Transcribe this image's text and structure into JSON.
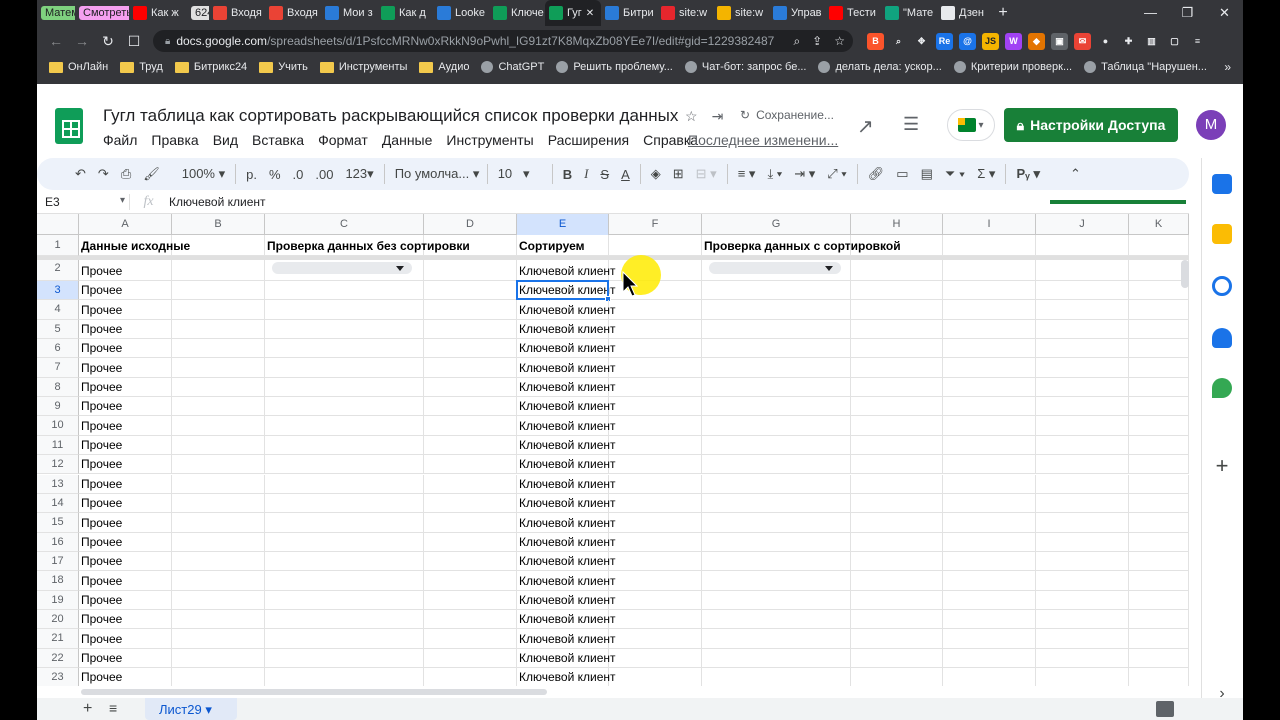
{
  "browser": {
    "tabs": [
      {
        "label": "Матем",
        "pill": true,
        "color": "#7fd17f"
      },
      {
        "label": "Смотреть",
        "pill": true,
        "color": "#f5a0f0"
      },
      {
        "label": "Как ж",
        "icon_color": "#ff0000",
        "icon": "youtube-icon"
      },
      {
        "label": "624",
        "pill": true,
        "color": "#e0e0e0"
      },
      {
        "label": "Входя",
        "icon_color": "#ea4335",
        "icon": "gmail-icon"
      },
      {
        "label": "Входя",
        "icon_color": "#ea4335",
        "icon": "gmail-icon"
      },
      {
        "label": "Мои з",
        "icon_color": "#2a7bd8",
        "icon": "bitrix-icon"
      },
      {
        "label": "Как д",
        "icon_color": "#0f9d58",
        "icon": "sheets-icon"
      },
      {
        "label": "Looke",
        "icon_color": "#2a7bd8",
        "icon": "bitrix-icon"
      },
      {
        "label": "Ключе",
        "icon_color": "#0f9d58",
        "icon": "sheets-icon"
      },
      {
        "label": "Гуг",
        "icon_color": "#0f9d58",
        "icon": "sheets-icon",
        "active": true
      },
      {
        "label": "Битри",
        "icon_color": "#2a7bd8",
        "icon": "bitrix-icon"
      },
      {
        "label": "site:w",
        "icon_color": "#e6262d",
        "icon": "yandex-icon"
      },
      {
        "label": "site:w",
        "icon_color": "#f4b400",
        "icon": "bookmark-icon"
      },
      {
        "label": "Управ",
        "icon_color": "#2a7bd8",
        "icon": "bitrix-icon"
      },
      {
        "label": "Тести",
        "icon_color": "#ff0000",
        "icon": "youtube-icon"
      },
      {
        "label": "\"Мате",
        "icon_color": "#10a37f",
        "icon": "chatgpt-icon"
      },
      {
        "label": "Дзен",
        "icon_color": "#e8eaed",
        "icon": "dzen-icon"
      }
    ],
    "url_host": "docs.google.com",
    "url_path": "/spreadsheets/d/1PsfccMRNw0xRkkN9oPwhl_IG91zt7K8MqxZb08YEe7I/edit#gid=1229382487",
    "bookmarks": [
      {
        "label": "ОнЛайн",
        "icon": "folder-icon"
      },
      {
        "label": "Труд",
        "icon": "folder-icon"
      },
      {
        "label": "Битрикс24",
        "icon": "folder-icon"
      },
      {
        "label": "Учить",
        "icon": "folder-icon"
      },
      {
        "label": "Инструменты",
        "icon": "folder-icon"
      },
      {
        "label": "Аудио",
        "icon": "folder-icon"
      },
      {
        "label": "ChatGPT",
        "icon": "chatgpt-icon"
      },
      {
        "label": "Решить проблему...",
        "icon": "page-icon"
      },
      {
        "label": "Чат-бот: запрос бе...",
        "icon": "bitrix-icon"
      },
      {
        "label": "делать дела: ускор...",
        "icon": "globe-icon"
      },
      {
        "label": "Критерии проверк...",
        "icon": "page-icon"
      },
      {
        "label": "Таблица \"Нарушен...",
        "icon": "page-icon"
      }
    ]
  },
  "doc": {
    "title": "Гугл таблица как сортировать раскрывающийся список проверки данных",
    "saving": "Сохранение...",
    "last_edit": "Последнее изменени...",
    "share_label": "Настройки Доступа",
    "avatar_letter": "M",
    "menus": [
      "Файл",
      "Правка",
      "Вид",
      "Вставка",
      "Формат",
      "Данные",
      "Инструменты",
      "Расширения",
      "Справка"
    ]
  },
  "toolbar": {
    "zoom": "100%",
    "currency": "р.",
    "percent": "%",
    "dec_less": ".0",
    "dec_more": ".00",
    "num_format": "123",
    "font": "По умолча...",
    "font_size": "10"
  },
  "formula_bar": {
    "name_box": "E3",
    "fx": "fx",
    "value": "Ключевой клиент"
  },
  "grid": {
    "columns": [
      "A",
      "B",
      "C",
      "D",
      "E",
      "F",
      "G",
      "H",
      "I",
      "J",
      "K"
    ],
    "header_row": {
      "A": "Данные исходные",
      "C": "Проверка данных без сортировки",
      "E": "Сортируем",
      "G": "Проверка данных с сортировкой"
    },
    "row_numbers": [
      "1",
      "2",
      "3",
      "4",
      "5",
      "6",
      "7",
      "8",
      "9",
      "10",
      "11",
      "12",
      "13",
      "14",
      "15",
      "16",
      "17",
      "18",
      "19",
      "20",
      "21",
      "22",
      "23"
    ],
    "col_a_value": "Прочее",
    "col_e_value": "Ключевой клиент",
    "selected_cell": "E3"
  },
  "sheets": {
    "active": "Лист29"
  },
  "colors": {
    "accent": "#188038",
    "selection": "#1a73e8",
    "header_select": "#d3e3fd"
  }
}
